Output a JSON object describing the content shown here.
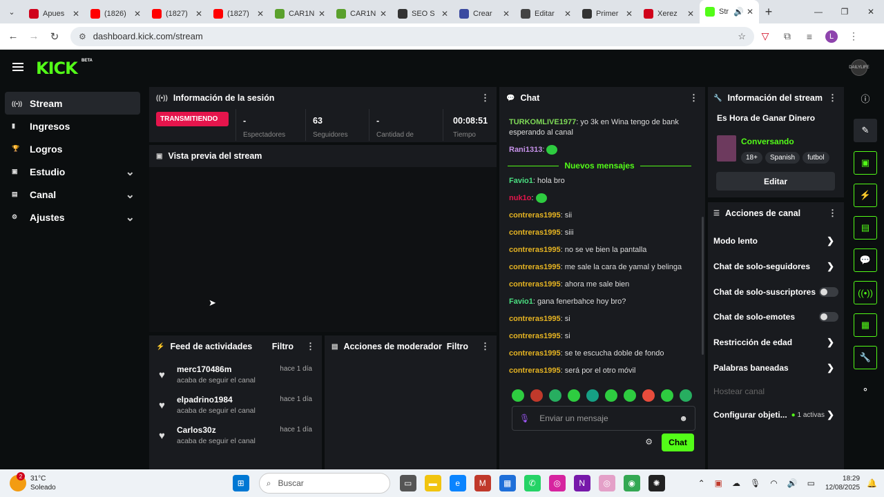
{
  "browser": {
    "tabs": [
      {
        "label": "Apues",
        "icon": "red-w-icon",
        "color": "#d0021b"
      },
      {
        "label": "(1826)",
        "icon": "youtube-icon",
        "color": "#ff0000"
      },
      {
        "label": "(1827)",
        "icon": "youtube-icon",
        "color": "#ff0000"
      },
      {
        "label": "(1827)",
        "icon": "youtube-icon",
        "color": "#ff0000"
      },
      {
        "label": "CAR1N",
        "icon": "shop-icon",
        "color": "#5aa02c"
      },
      {
        "label": "CAR1N",
        "icon": "shop-icon",
        "color": "#5aa02c"
      },
      {
        "label": "SEO S",
        "icon": "chatgpt-icon",
        "color": "#333333"
      },
      {
        "label": "Crear",
        "icon": "p-icon",
        "color": "#3b4aa0"
      },
      {
        "label": "Editar",
        "icon": "doc-icon",
        "color": "#444444"
      },
      {
        "label": "Primer",
        "icon": "feather-icon",
        "color": "#333333"
      },
      {
        "label": "Xerez",
        "icon": "red-w-icon",
        "color": "#d0021b"
      },
      {
        "label": "Str",
        "icon": "kick-icon",
        "color": "#53fc18"
      }
    ],
    "url": "dashboard.kick.com/stream",
    "profile_letter": "L"
  },
  "app": {
    "logo": "KICK",
    "logo_badge": "BETA",
    "user_avatar": "DAILYLIFE",
    "nav": [
      {
        "label": "Stream",
        "icon": "broadcast-icon",
        "active": true,
        "expandable": false
      },
      {
        "label": "Ingresos",
        "icon": "chart-icon",
        "active": false,
        "expandable": false
      },
      {
        "label": "Logros",
        "icon": "trophy-icon",
        "active": false,
        "expandable": false
      },
      {
        "label": "Estudio",
        "icon": "camera-icon",
        "active": false,
        "expandable": true
      },
      {
        "label": "Canal",
        "icon": "channel-icon",
        "active": false,
        "expandable": true
      },
      {
        "label": "Ajustes",
        "icon": "gear-icon",
        "active": false,
        "expandable": true
      }
    ]
  },
  "session": {
    "title": "Información de la sesión",
    "status": "TRANSMITIENDO",
    "stats": [
      {
        "value": "-",
        "label": "Espectadores"
      },
      {
        "value": "63",
        "label": "Seguidores"
      },
      {
        "value": "-",
        "label": "Cantidad de"
      },
      {
        "value": "00:08:51",
        "label": "Tiempo"
      }
    ]
  },
  "preview": {
    "title": "Vista previa del stream"
  },
  "feed": {
    "title": "Feed de actividades",
    "filter": "Filtro",
    "items": [
      {
        "name": "merc170486m",
        "desc": "acaba de seguir el canal",
        "time": "hace 1 día"
      },
      {
        "name": "elpadrino1984",
        "desc": "acaba de seguir el canal",
        "time": "hace 1 día"
      },
      {
        "name": "Carlos30z",
        "desc": "acaba de seguir el canal",
        "time": "hace 1 día"
      }
    ]
  },
  "moderator": {
    "title": "Acciones de moderador",
    "filter": "Filtro"
  },
  "chat": {
    "title": "Chat",
    "new_messages": "Nuevos mensajes",
    "messages_before": [
      {
        "user": "TURKOMLIVE1977",
        "color": "#7ed957",
        "text": "yo 3k en Wina tengo de bank esperando al canal"
      },
      {
        "user": "Rani1313",
        "color": "#c792ea",
        "text": "",
        "emote": true
      }
    ],
    "messages_after": [
      {
        "user": "Favio1",
        "color": "#4ade80",
        "text": "hola bro",
        "emote": false
      },
      {
        "user": "nuk1o",
        "color": "#e5154c",
        "text": "",
        "emote": true
      },
      {
        "user": "contreras1995",
        "color": "#e6b422",
        "text": "sii",
        "emote": false
      },
      {
        "user": "contreras1995",
        "color": "#e6b422",
        "text": "siii",
        "emote": false
      },
      {
        "user": "contreras1995",
        "color": "#e6b422",
        "text": "no se ve bien la pantalla",
        "emote": false
      },
      {
        "user": "contreras1995",
        "color": "#e6b422",
        "text": "me sale la cara de yamal y belinga",
        "emote": false
      },
      {
        "user": "contreras1995",
        "color": "#e6b422",
        "text": "ahora me sale bien",
        "emote": false
      },
      {
        "user": "Favio1",
        "color": "#4ade80",
        "text": "gana fenerbahce hoy bro?",
        "emote": false
      },
      {
        "user": "contreras1995",
        "color": "#e6b422",
        "text": "si",
        "emote": false
      },
      {
        "user": "contreras1995",
        "color": "#e6b422",
        "text": "si",
        "emote": false
      },
      {
        "user": "contreras1995",
        "color": "#e6b422",
        "text": "se te escucha doble de fondo",
        "emote": false
      },
      {
        "user": "contreras1995",
        "color": "#e6b422",
        "text": "será por el otro móvil",
        "emote": false
      }
    ],
    "input_placeholder": "Enviar un mensaje",
    "send_label": "Chat"
  },
  "stream_info": {
    "title": "Información del stream",
    "stream_title": "Es Hora de Ganar Dinero",
    "category": "Conversando",
    "tags": [
      "18+",
      "Spanish",
      "futbol"
    ],
    "edit_label": "Editar"
  },
  "channel_actions": {
    "title": "Acciones de canal",
    "items": [
      {
        "label": "Modo lento",
        "kind": "arrow"
      },
      {
        "label": "Chat de solo-seguidores",
        "kind": "arrow"
      },
      {
        "label": "Chat de solo-suscriptores",
        "kind": "toggle"
      },
      {
        "label": "Chat de solo-emotes",
        "kind": "toggle"
      },
      {
        "label": "Restricción de edad",
        "kind": "arrow"
      },
      {
        "label": "Palabras baneadas",
        "kind": "arrow"
      }
    ],
    "host_label": "Hostear canal",
    "goals_label": "Configurar objeti...",
    "goals_active": "1 activas"
  },
  "taskbar": {
    "weather_temp": "31°C",
    "weather_desc": "Soleado",
    "weather_badge": "2",
    "search_placeholder": "Buscar",
    "time": "18:29",
    "date": "12/08/2025"
  }
}
